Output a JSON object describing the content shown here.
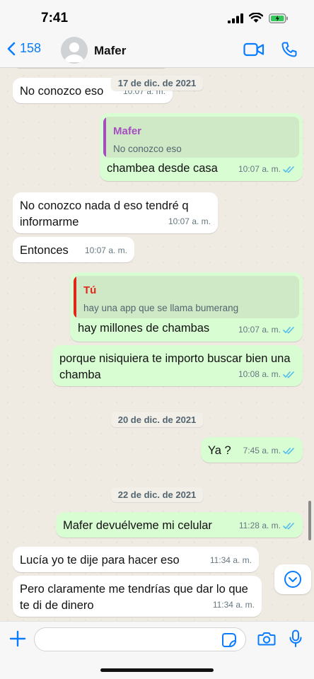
{
  "status_bar": {
    "time": "7:41"
  },
  "header": {
    "back_count": "158",
    "contact_name": "Mafer"
  },
  "colors": {
    "accent": "#0a7cff",
    "outgoing_bubble": "#d9fdd3",
    "incoming_bubble": "#ffffff",
    "read_ticks": "#53bdeb",
    "quote_mafer": "#a64dc0",
    "quote_you": "#e0261b"
  },
  "messages": [
    {
      "direction": "incoming",
      "text": "No conozco eso",
      "time": "10:07 a. m."
    },
    {
      "direction": "outgoing",
      "quote_author": "Mafer",
      "quote_text": "No conozco eso",
      "text": "chambea desde casa",
      "time": "10:07 a. m.",
      "status": "read"
    },
    {
      "direction": "incoming",
      "text": "No conozco nada d eso tendré q informarme",
      "time": "10:07 a. m."
    },
    {
      "direction": "incoming",
      "text": "Entonces",
      "time": "10:07 a. m."
    },
    {
      "direction": "outgoing",
      "quote_author": "Tú",
      "quote_text": "hay una app que se llama bumerang",
      "text": "hay millones de chambas",
      "time": "10:07 a. m.",
      "status": "read"
    },
    {
      "direction": "outgoing",
      "text": "porque nisiquiera te importo buscar bien una chamba",
      "time": "10:08 a. m.",
      "status": "read"
    },
    {
      "direction": "outgoing",
      "text": "Ya ?",
      "time": "7:45 a. m.",
      "status": "read"
    },
    {
      "direction": "outgoing",
      "text": "Mafer devuélveme mi celular",
      "time": "11:28 a. m.",
      "status": "read"
    },
    {
      "direction": "incoming",
      "text": "Lucía yo te dije para hacer eso",
      "time": "11:34 a. m."
    },
    {
      "direction": "incoming",
      "text": "Pero claramente me tendrías que dar lo que te di de dinero",
      "time": "11:34 a. m."
    }
  ],
  "date_chips": [
    "17 de dic. de 2021",
    "20 de dic. de 2021",
    "22 de dic. de 2021"
  ],
  "input": {
    "placeholder": "",
    "value": ""
  },
  "icons": [
    "back-chevron-icon",
    "avatar-icon",
    "video-camera-icon",
    "phone-icon",
    "chevron-down-icon",
    "plus-icon",
    "sticker-icon",
    "camera-icon",
    "microphone-icon"
  ]
}
